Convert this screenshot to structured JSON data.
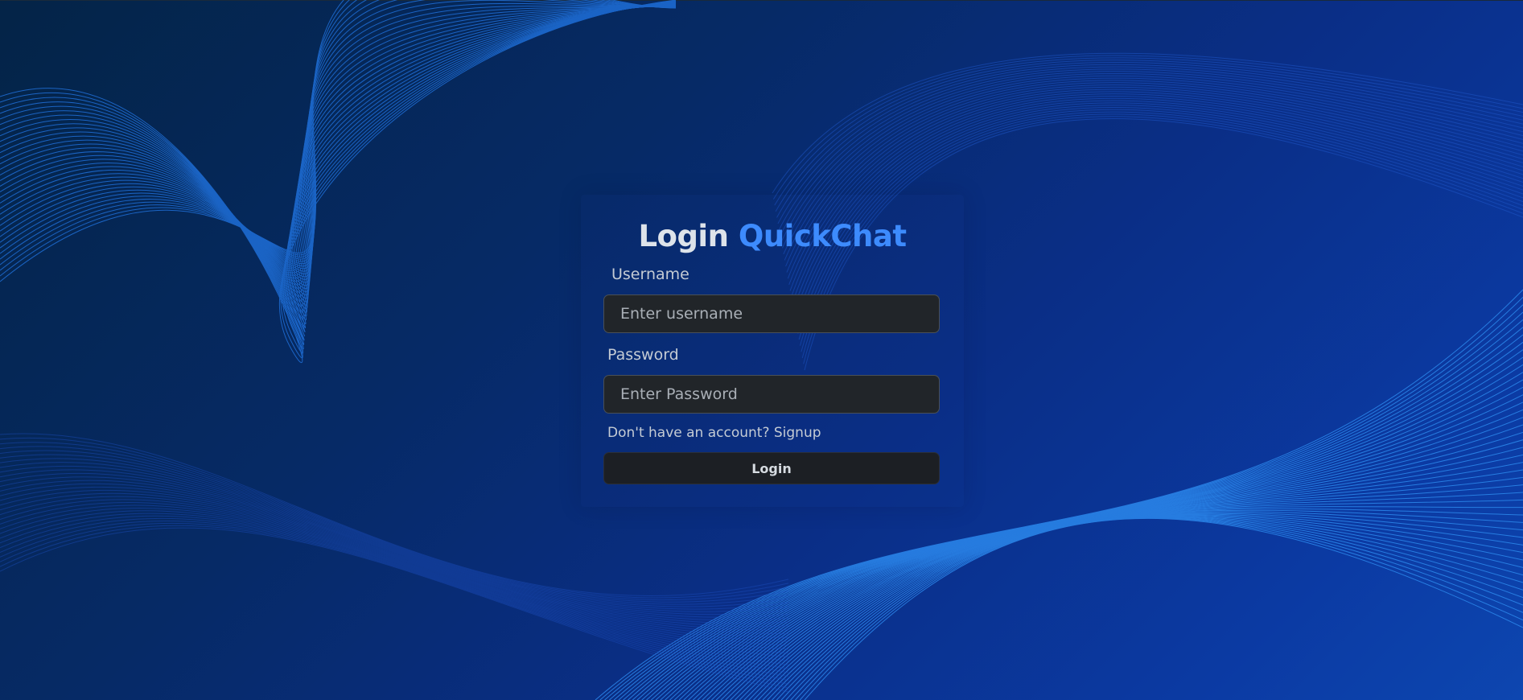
{
  "page": {
    "title_part1": "Login",
    "title_part2": "QuickChat"
  },
  "form": {
    "username_label": "Username",
    "username_placeholder": "Enter username",
    "username_value": "",
    "password_label": "Password",
    "password_placeholder": "Enter Password",
    "password_value": "",
    "signup_text": "Don't have an account? Signup",
    "login_button": "Login"
  },
  "colors": {
    "accent": "#3d8bfd",
    "input_bg": "#212529",
    "button_bg": "#1c1f24",
    "background_dark": "#042447",
    "background_blue": "#0d46b0",
    "wave_lines": "#1f7ae0"
  }
}
